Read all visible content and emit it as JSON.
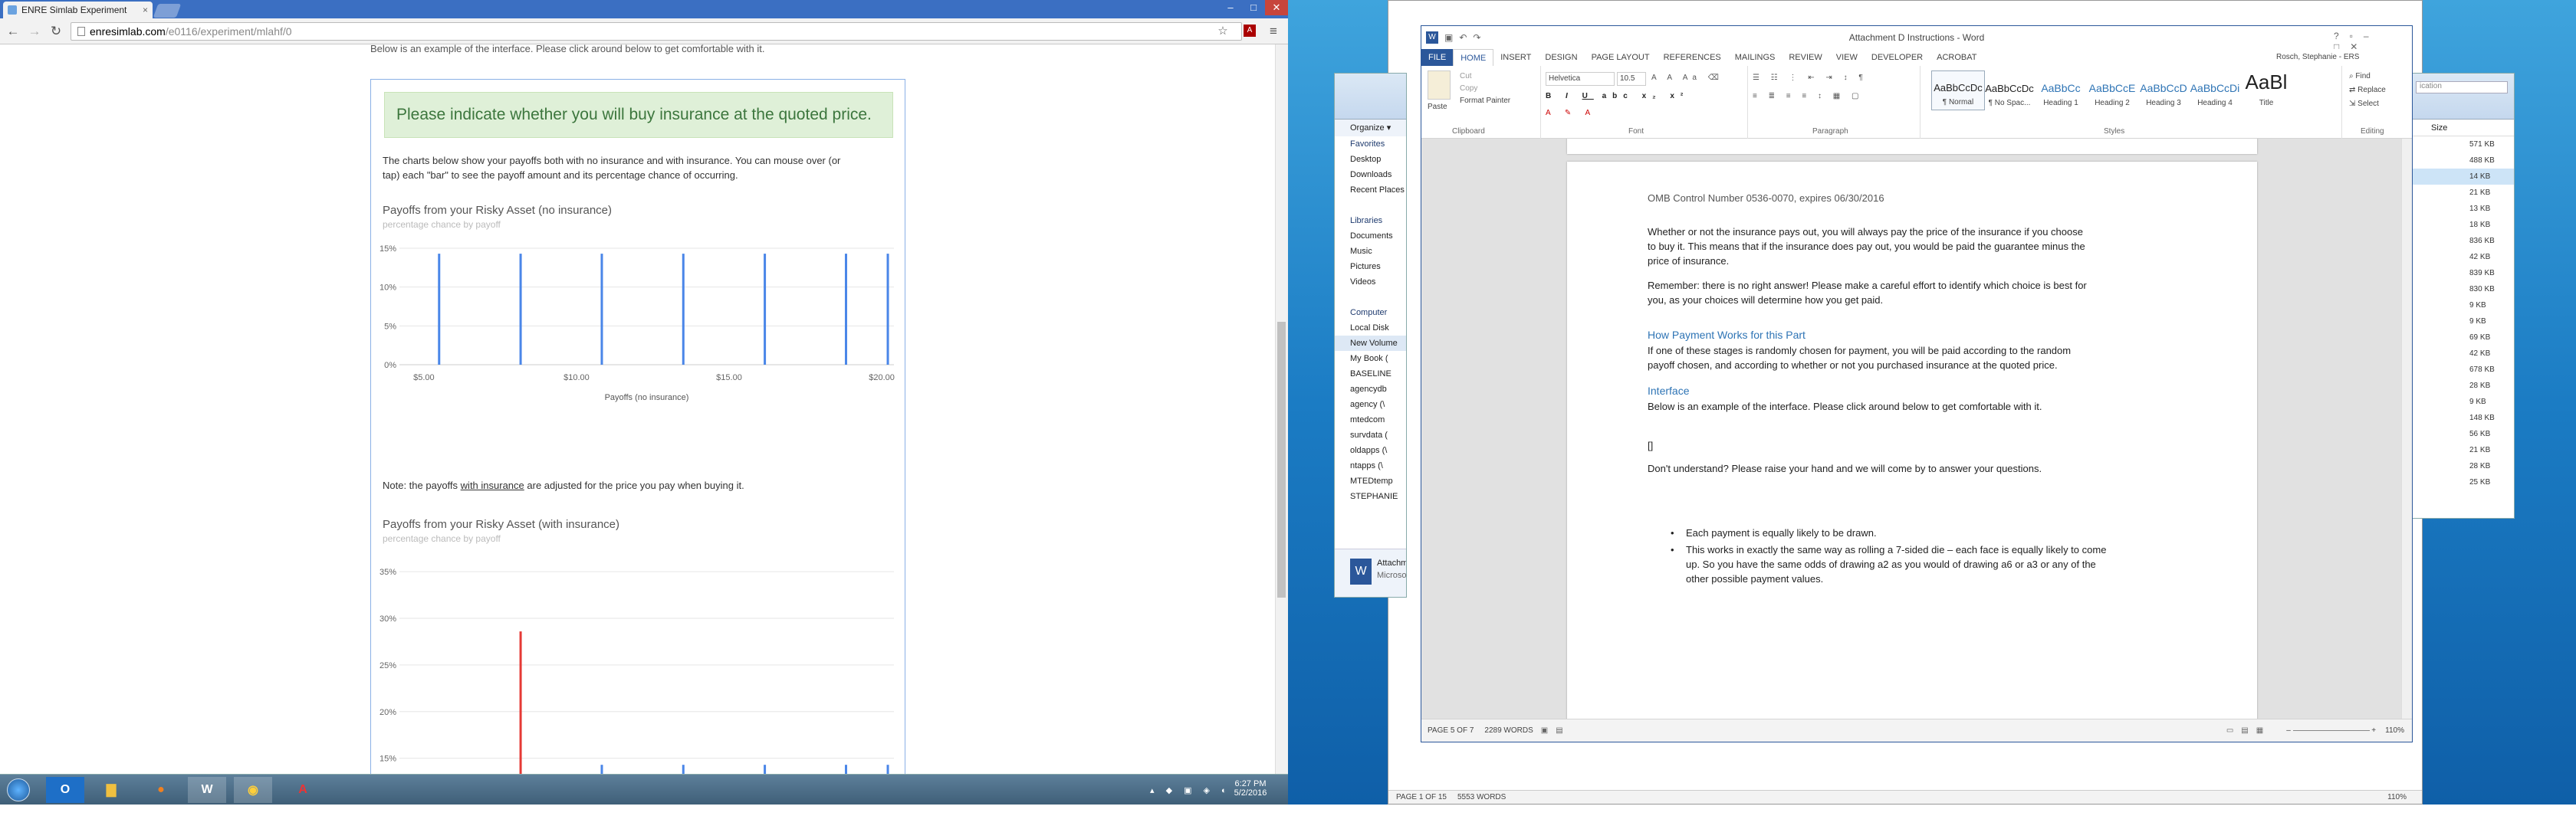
{
  "browser": {
    "tab_title": "ENRE Simlab Experiment",
    "url_host": "enresimlab.com",
    "url_path": "/e0116/experiment/mlahf/0",
    "close_glyph": "×"
  },
  "page": {
    "intro_cut": "Below is an example of the interface. Please click around below to get comfortable with it.",
    "alert": "Please indicate whether you will buy insurance at the quoted price.",
    "description_line1": "The charts below show your payoffs both with no insurance and with insurance. You can mouse over (or",
    "description_line2": "tap) each \"bar\" to see the payoff amount and its percentage chance of occurring.",
    "note_prefix": "Note: the payoffs ",
    "note_link": "with insurance",
    "note_suffix": " are adjusted for the price you pay when buying it."
  },
  "chart_data": [
    {
      "type": "bar",
      "title": "Payoffs from your Risky Asset (no insurance)",
      "subtitle": "percentage chance by payoff",
      "xlabel": "Payoffs (no insurance)",
      "ylabel": "",
      "yticks": [
        "0%",
        "5%",
        "10%",
        "15%"
      ],
      "xticks": [
        "$5.00",
        "$10.00",
        "$15.00",
        "$20.00"
      ],
      "xlim": [
        4.2,
        20.4
      ],
      "ylim": [
        0,
        15
      ],
      "x": [
        5.5,
        8.17,
        10.83,
        13.5,
        16.17,
        18.83,
        20.2
      ],
      "values": [
        14.3,
        14.3,
        14.3,
        14.3,
        14.3,
        14.3,
        14.3
      ],
      "color": "#4a86e8"
    },
    {
      "type": "bar",
      "title": "Payoffs from your Risky Asset (with insurance)",
      "subtitle": "percentage chance by payoff",
      "xlabel": "",
      "ylabel": "",
      "yticks": [
        "15%",
        "20%",
        "25%",
        "30%",
        "35%"
      ],
      "ylim": [
        13,
        36
      ],
      "xlim": [
        4.2,
        20.4
      ],
      "bars": [
        {
          "x": 8.17,
          "value": 28.6,
          "color": "#e53935"
        },
        {
          "x": 10.83,
          "value": 14.3,
          "color": "#4a86e8"
        },
        {
          "x": 13.5,
          "value": 14.3,
          "color": "#4a86e8"
        },
        {
          "x": 16.17,
          "value": 14.3,
          "color": "#4a86e8"
        },
        {
          "x": 18.83,
          "value": 14.3,
          "color": "#4a86e8"
        },
        {
          "x": 20.2,
          "value": 14.3,
          "color": "#4a86e8"
        }
      ]
    }
  ],
  "taskbar_left": {
    "time": "6:27 PM",
    "date": "5/2/2016"
  },
  "word": {
    "title": "Attachment D Instructions - Word",
    "tabs": [
      "FILE",
      "HOME",
      "INSERT",
      "DESIGN",
      "PAGE LAYOUT",
      "REFERENCES",
      "MAILINGS",
      "REVIEW",
      "VIEW",
      "DEVELOPER",
      "ACROBAT"
    ],
    "user": "Rosch, Stephanie - ERS",
    "clipboard": {
      "paste": "Paste",
      "cut": "Cut",
      "copy": "Copy",
      "format_painter": "Format Painter",
      "label": "Clipboard"
    },
    "font": {
      "name": "Helvetica",
      "size": "10.5",
      "label": "Font"
    },
    "paragraph_label": "Paragraph",
    "styles_label": "Styles",
    "editing": {
      "find": "Find",
      "replace": "Replace",
      "select": "Select",
      "label": "Editing"
    },
    "styles": [
      {
        "sample": "AaBbCcDc",
        "name": "¶ Normal",
        "kind": "n"
      },
      {
        "sample": "AaBbCcDc",
        "name": "¶ No Spac...",
        "kind": "n"
      },
      {
        "sample": "AaBbCc",
        "name": "Heading 1",
        "kind": "h"
      },
      {
        "sample": "AaBbCcE",
        "name": "Heading 2",
        "kind": "h"
      },
      {
        "sample": "AaBbCcD",
        "name": "Heading 3",
        "kind": "h"
      },
      {
        "sample": "AaBbCcDi",
        "name": "Heading 4",
        "kind": "h"
      },
      {
        "sample": "AaBl",
        "name": "Title",
        "kind": "t"
      }
    ],
    "doc": {
      "omb": "OMB Control Number 0536-0070, expires 06/30/2016",
      "p1": [
        "Whether or not the insurance pays out, you will always pay the price of the insurance if you choose",
        "to buy it. This means that if the insurance does pay out, you would be paid the guarantee minus the",
        "price of insurance."
      ],
      "p2": [
        "Remember: there is no right answer! Please make a careful effort to identify which choice is best for",
        "you, as your choices will determine how you get paid."
      ],
      "h1": "How Payment Works for this Part",
      "p3": [
        "If one of these stages is randomly chosen for payment, you will be paid according to the random",
        "payoff chosen, and according to whether or not you purchased insurance at the quoted price."
      ],
      "h2": "Interface",
      "p4": "Below is an example of the interface. Please click around below to get comfortable with it.",
      "placeholder": "[]",
      "p5": "Don't understand?  Please raise your hand and we will come by to answer your questions.",
      "bullets": [
        [
          "Each payment is equally likely to be drawn."
        ],
        [
          "This works in exactly the same way as rolling a 7-sided die – each face is equally likely to come",
          "up.  So you have the same odds of drawing a2 as you would of drawing a6 or a3 or any of the",
          "other possible payment values."
        ]
      ]
    },
    "status": {
      "page": "PAGE 5 OF 7",
      "words": "2289 WORDS",
      "zoom": "110%"
    }
  },
  "word2_status": {
    "page": "PAGE 1 OF 15",
    "words": "5553 WORDS",
    "zoom": "110%"
  },
  "explorer": {
    "organize": "Organize ▾",
    "items": [
      "Favorites",
      "Desktop",
      "Downloads",
      "Recent Places",
      "",
      "Libraries",
      "Documents",
      "Music",
      "Pictures",
      "Videos",
      "",
      "Computer",
      "Local Disk",
      "New Volume",
      "My Book (",
      "BASELINE",
      "agencydb",
      "agency (\\",
      "mtedcom",
      "survdata (",
      "oldapps (\\",
      "ntapps (\\",
      "MTEDtemp",
      "STEPHANIE"
    ],
    "attach_title": "Attachment",
    "attach_sub": "Microsoft"
  },
  "explorer_right": {
    "search": "ication",
    "size_header": "Size",
    "sizes": [
      "571 KB",
      "488 KB",
      "14 KB",
      "21 KB",
      "13 KB",
      "18 KB",
      "836 KB",
      "42 KB",
      "839 KB",
      "830 KB",
      "9 KB",
      "9 KB",
      "69 KB",
      "42 KB",
      "678 KB",
      "28 KB",
      "9 KB",
      "148 KB",
      "56 KB",
      "21 KB",
      "28 KB",
      "25 KB"
    ]
  },
  "colors": {
    "word_blue": "#2b579a",
    "chrome_blue": "#3b6fc2",
    "alert_green": "#dff0d8",
    "bar_blue": "#4a86e8",
    "bar_red": "#e53935"
  }
}
